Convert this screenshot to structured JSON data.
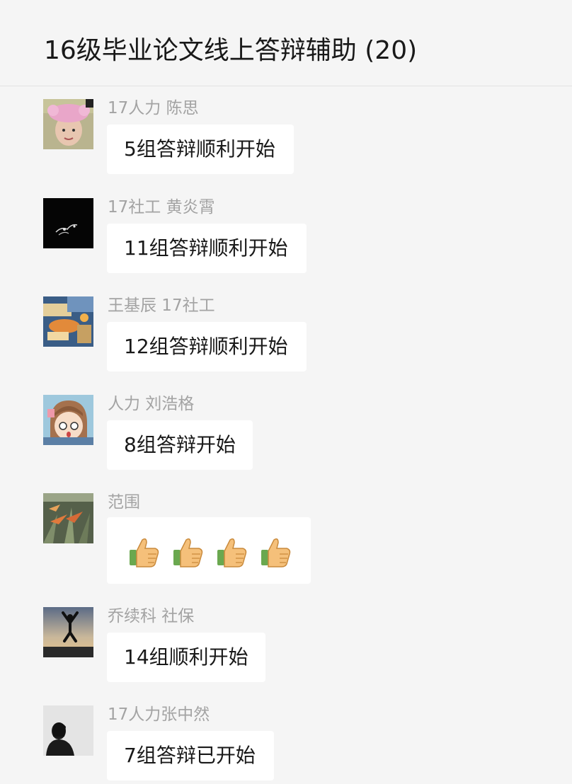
{
  "header": {
    "title": "16级毕业论文线上答辩辅助 (20)"
  },
  "messages": [
    {
      "sender": "17人力 陈思",
      "text": "5组答辩顺利开始",
      "avatar": "person-pink-hat-avatar"
    },
    {
      "sender": "17社工 黄炎霄",
      "text": "11组答辩顺利开始",
      "avatar": "dark-drawing-avatar"
    },
    {
      "sender": "王基辰 17社工",
      "text": "12组答辩顺利开始",
      "avatar": "painting-avatar"
    },
    {
      "sender": "人力 刘浩格",
      "text": "8组答辩开始",
      "avatar": "anime-girl-avatar"
    },
    {
      "sender": "范围",
      "emoji": [
        "thumbs-up",
        "thumbs-up",
        "thumbs-up",
        "thumbs-up"
      ],
      "avatar": "flowers-avatar"
    },
    {
      "sender": "乔续科  社保",
      "text": "14组顺利开始",
      "avatar": "jumping-person-sunset-avatar"
    },
    {
      "sender": "17人力张中然",
      "text": "7组答辩已开始",
      "avatar": "silhouette-avatar"
    }
  ]
}
